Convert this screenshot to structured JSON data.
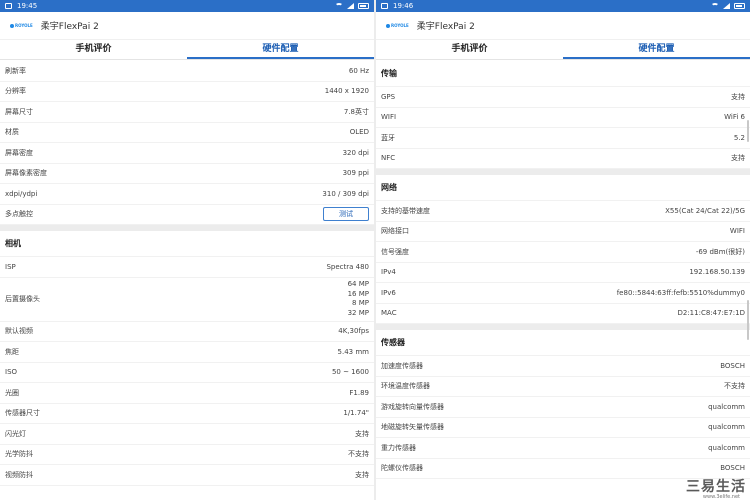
{
  "left": {
    "status": {
      "time": "19:45"
    },
    "app": {
      "title": "柔宇FlexPai 2",
      "logo_text": "ROYOLE"
    },
    "tabs": [
      {
        "label": "手机评价"
      },
      {
        "label": "硬件配置"
      }
    ],
    "display_rows": [
      {
        "label": "刷新率",
        "value": "60 Hz"
      },
      {
        "label": "分辨率",
        "value": "1440 x 1920"
      },
      {
        "label": "屏幕尺寸",
        "value": "7.8英寸"
      },
      {
        "label": "材质",
        "value": "OLED"
      },
      {
        "label": "屏幕密度",
        "value": "320 dpi"
      },
      {
        "label": "屏幕像素密度",
        "value": "309 ppi"
      },
      {
        "label": "xdpi/ydpi",
        "value": "310 / 309 dpi"
      }
    ],
    "multitouch": {
      "label": "多点触控",
      "button": "测试"
    },
    "camera": {
      "title": "相机",
      "isp": {
        "label": "ISP",
        "value": "Spectra 480"
      },
      "rear": {
        "label": "后置摄像头",
        "values": [
          "64 MP",
          "16 MP",
          "8 MP",
          "32 MP"
        ]
      },
      "rows": [
        {
          "label": "默认视频",
          "value": "4K,30fps"
        },
        {
          "label": "焦距",
          "value": "5.43 mm"
        },
        {
          "label": "ISO",
          "value": "50 ~ 1600"
        },
        {
          "label": "光圈",
          "value": "F1.89"
        },
        {
          "label": "传感器尺寸",
          "value": "1/1.74\""
        },
        {
          "label": "闪光灯",
          "value": "支持"
        },
        {
          "label": "光学防抖",
          "value": "不支持"
        },
        {
          "label": "视频防抖",
          "value": "支持"
        }
      ]
    }
  },
  "right": {
    "status": {
      "time": "19:46"
    },
    "app": {
      "title": "柔宇FlexPai 2",
      "logo_text": "ROYOLE"
    },
    "tabs": [
      {
        "label": "手机评价"
      },
      {
        "label": "硬件配置"
      }
    ],
    "transport": {
      "title": "传输",
      "rows": [
        {
          "label": "GPS",
          "value": "支持"
        },
        {
          "label": "WIFI",
          "value": "WiFi 6"
        },
        {
          "label": "蓝牙",
          "value": "5.2"
        },
        {
          "label": "NFC",
          "value": "支持"
        }
      ]
    },
    "network": {
      "title": "网络",
      "rows": [
        {
          "label": "支持的基带速度",
          "value": "X55(Cat 24/Cat 22)/5G"
        },
        {
          "label": "网络接口",
          "value": "WIFI"
        },
        {
          "label": "信号强度",
          "value": "-69 dBm(很好)"
        },
        {
          "label": "IPv4",
          "value": "192.168.50.139"
        },
        {
          "label": "IPv6",
          "value": "fe80::5844:63ff:fefb:5510%dummy0"
        },
        {
          "label": "MAC",
          "value": "D2:11:C8:47:E7:1D"
        }
      ]
    },
    "sensors": {
      "title": "传感器",
      "rows": [
        {
          "label": "加速度传感器",
          "value": "BOSCH"
        },
        {
          "label": "环境温度传感器",
          "value": "不支持"
        },
        {
          "label": "游戏旋转向量传感器",
          "value": "qualcomm"
        },
        {
          "label": "地磁旋转矢量传感器",
          "value": "qualcomm"
        },
        {
          "label": "重力传感器",
          "value": "qualcomm"
        },
        {
          "label": "陀螺仪传感器",
          "value": "BOSCH"
        }
      ]
    }
  },
  "watermark": {
    "text": "三易生活",
    "sub": "www.3elife.net"
  },
  "colors": {
    "statusbar": "#2b6fc7",
    "accent": "#1e5fb4"
  }
}
